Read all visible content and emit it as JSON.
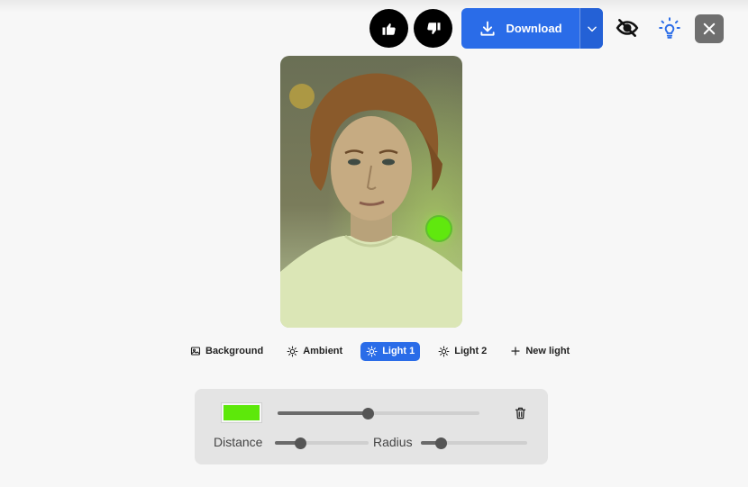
{
  "toolbar": {
    "like_icon": "thumbs-up-icon",
    "dislike_icon": "thumbs-down-icon",
    "download_label": "Download",
    "accent_color": "#2a6ce8"
  },
  "photo": {
    "ambient_light_color": "#b39c43",
    "light1_color": "#60e80e"
  },
  "tabs": [
    {
      "label": "Background",
      "icon": "image-icon",
      "active": false
    },
    {
      "label": "Ambient",
      "icon": "sun-icon",
      "active": false
    },
    {
      "label": "Light 1",
      "icon": "sun-icon",
      "active": true
    },
    {
      "label": "Light 2",
      "icon": "sun-icon",
      "active": false
    },
    {
      "label": "New light",
      "icon": "plus-icon",
      "active": false
    }
  ],
  "light_panel": {
    "color_hex": "#5de80a",
    "intensity_fraction": 0.45,
    "distance_label": "Distance",
    "distance_fraction": 0.27,
    "radius_label": "Radius",
    "radius_fraction": 0.19
  }
}
